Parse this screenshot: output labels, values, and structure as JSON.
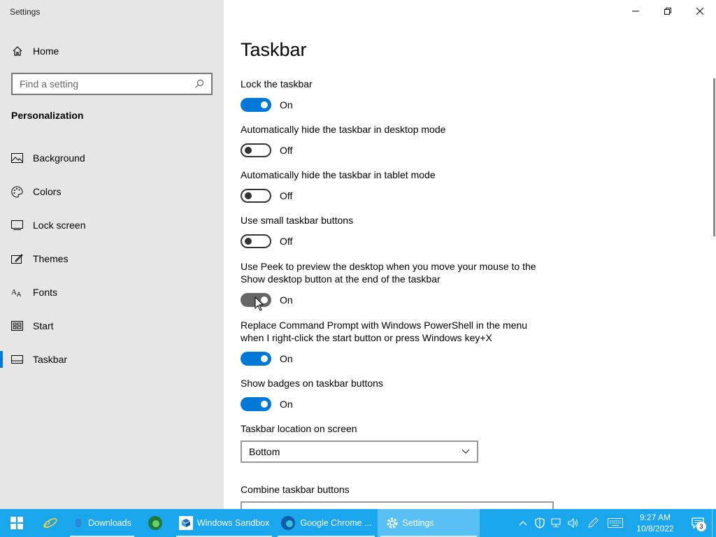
{
  "window": {
    "title": "Settings"
  },
  "sidebar": {
    "home_label": "Home",
    "search_placeholder": "Find a setting",
    "section_title": "Personalization",
    "items": [
      {
        "label": "Background",
        "icon": "background-icon",
        "active": false
      },
      {
        "label": "Colors",
        "icon": "palette-icon",
        "active": false
      },
      {
        "label": "Lock screen",
        "icon": "lock-screen-icon",
        "active": false
      },
      {
        "label": "Themes",
        "icon": "themes-icon",
        "active": false
      },
      {
        "label": "Fonts",
        "icon": "fonts-icon",
        "active": false
      },
      {
        "label": "Start",
        "icon": "start-icon",
        "active": false
      },
      {
        "label": "Taskbar",
        "icon": "taskbar-icon",
        "active": true
      }
    ]
  },
  "main": {
    "title": "Taskbar",
    "settings": [
      {
        "label": "Lock the taskbar",
        "state": "On"
      },
      {
        "label": "Automatically hide the taskbar in desktop mode",
        "state": "Off"
      },
      {
        "label": "Automatically hide the taskbar in tablet mode",
        "state": "Off"
      },
      {
        "label": "Use small taskbar buttons",
        "state": "Off"
      },
      {
        "label": "Use Peek to preview the desktop when you move your mouse to the Show desktop button at the end of the taskbar",
        "state": "On"
      },
      {
        "label": "Replace Command Prompt with Windows PowerShell in the menu when I right-click the start button or press Windows key+X",
        "state": "On"
      },
      {
        "label": "Show badges on taskbar buttons",
        "state": "On"
      }
    ],
    "location_label": "Taskbar location on screen",
    "location_value": "Bottom",
    "combine_label": "Combine taskbar buttons"
  },
  "taskbar": {
    "apps": [
      {
        "label": "Downloads",
        "icon": "folder-icon"
      },
      {
        "label": "Windows Sandbox",
        "icon": "sandbox-icon"
      },
      {
        "label": "Google Chrome ...",
        "icon": "edge-icon"
      },
      {
        "label": "Settings",
        "icon": "gear-icon"
      }
    ],
    "time": "9:27 AM",
    "date": "10/8/2022",
    "notification_count": "3"
  },
  "colors": {
    "accent": "#0078d7",
    "taskbar": "#1aa6ec",
    "sidebar": "#e6e6e6"
  }
}
